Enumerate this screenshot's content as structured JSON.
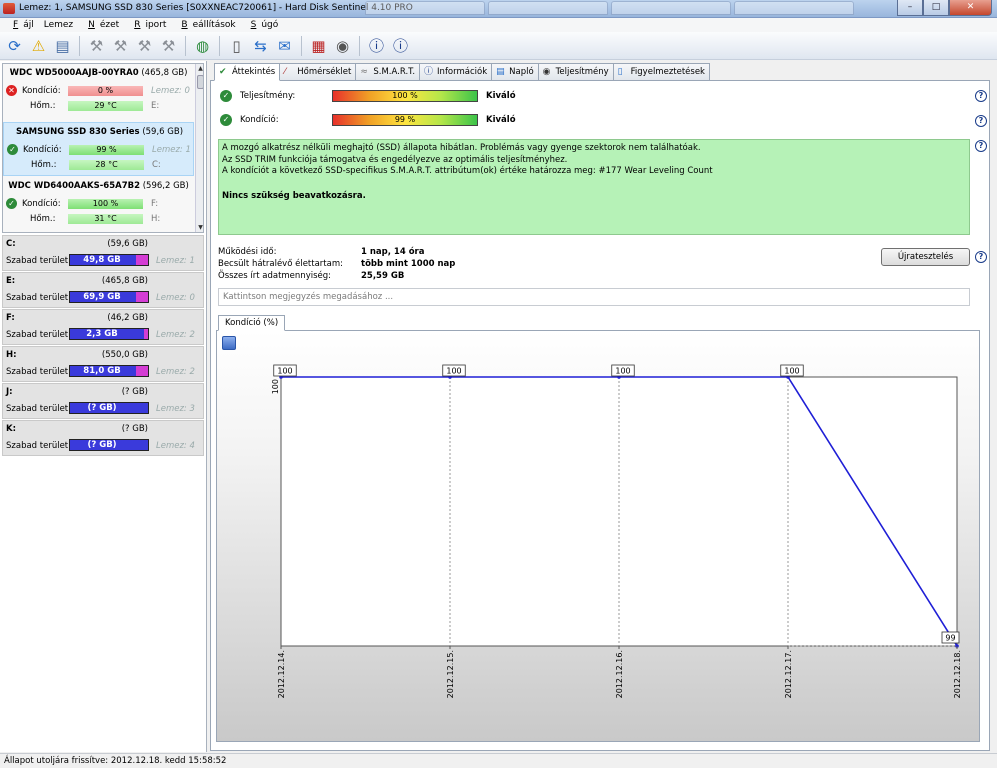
{
  "window": {
    "title": "Lemez: 1, SAMSUNG SSD 830 Series [S0XXNEAC720061]  -  Hard Disk Sentinel 4.10 PRO",
    "minimize": "–",
    "maximize": "□",
    "close": "✕"
  },
  "menu": [
    {
      "label": "Fájl",
      "key": "F"
    },
    {
      "label": "Lemez"
    },
    {
      "label": "Nézet",
      "key": "N"
    },
    {
      "label": "Riport",
      "key": "R"
    },
    {
      "label": "Beállítások",
      "key": "B"
    },
    {
      "label": "Súgó",
      "key": "S"
    }
  ],
  "disks": [
    {
      "name": "WDC WD5000AAJB-00YRA0",
      "size": "(465,8 GB)",
      "condition_label": "Kondíció:",
      "condition": "0 %",
      "temp_label": "Hőm.:",
      "temp": "29 °C",
      "lemez": "Lemez: 0",
      "drive": "E:",
      "status": "bad"
    },
    {
      "name": "SAMSUNG SSD 830 Series",
      "size": "(59,6 GB)",
      "condition_label": "Kondíció:",
      "condition": "99 %",
      "temp_label": "Hőm.:",
      "temp": "28 °C",
      "lemez": "Lemez: 1",
      "drive": "C:",
      "status": "ok"
    },
    {
      "name": "WDC WD6400AAKS-65A7B2",
      "size": "(596,2 GB)",
      "condition_label": "Kondíció:",
      "condition": "100 %",
      "temp_label": "Hőm.:",
      "temp": "31 °C",
      "lemez": "F:",
      "drive": "H:",
      "status": "ok"
    }
  ],
  "volumes": [
    {
      "name": "C:",
      "size": "(59,6 GB)",
      "free_label": "Szabad terület",
      "free": "49,8 GB",
      "lemez": "Lemez: 1",
      "used_fraction": 0.16
    },
    {
      "name": "E:",
      "size": "(465,8 GB)",
      "free_label": "Szabad terület",
      "free": "69,9 GB",
      "lemez": "Lemez: 0",
      "used_fraction": 0.15
    },
    {
      "name": "F:",
      "size": "(46,2 GB)",
      "free_label": "Szabad terület",
      "free": "2,3 GB",
      "lemez": "Lemez: 2",
      "used_fraction": 0.05
    },
    {
      "name": "H:",
      "size": "(550,0 GB)",
      "free_label": "Szabad terület",
      "free": "81,0 GB",
      "lemez": "Lemez: 2",
      "used_fraction": 0.15
    },
    {
      "name": "J:",
      "size": "(? GB)",
      "free_label": "Szabad terület",
      "free": "(? GB)",
      "lemez": "Lemez: 3",
      "used_fraction": 0
    },
    {
      "name": "K:",
      "size": "(? GB)",
      "free_label": "Szabad terület",
      "free": "(? GB)",
      "lemez": "Lemez: 4",
      "used_fraction": 0
    }
  ],
  "tabs": [
    {
      "label": "Áttekintés",
      "icon": "check-icon",
      "active": true
    },
    {
      "label": "Hőmérséklet",
      "icon": "thermometer-icon"
    },
    {
      "label": "S.M.A.R.T.",
      "icon": "smart-icon"
    },
    {
      "label": "Információk",
      "icon": "info-icon"
    },
    {
      "label": "Napló",
      "icon": "log-icon"
    },
    {
      "label": "Teljesítmény",
      "icon": "performance-icon"
    },
    {
      "label": "Figyelmeztetések",
      "icon": "alert-icon"
    }
  ],
  "overview": {
    "performance_label": "Teljesítmény:",
    "performance_value": "100 %",
    "performance_rating": "Kiváló",
    "condition_label": "Kondíció:",
    "condition_value": "99 %",
    "condition_rating": "Kiváló",
    "status_lines": [
      "A mozgó alkatrész nélküli meghajtó (SSD) állapota hibátlan. Problémás vagy gyenge szektorok nem találhatóak.",
      "Az SSD TRIM funkciója támogatva és engedélyezve az optimális teljesítményhez.",
      "A kondíciót a következő SSD-specifikus S.M.A.R.T. attribútum(ok) értéke határozza meg:  #177 Wear Leveling Count"
    ],
    "status_strong": "Nincs szükség beavatkozásra.",
    "uptime_label": "Működési idő:",
    "uptime_value": "1 nap, 14 óra",
    "lifetime_label": "Becsült hátralévő élettartam:",
    "lifetime_value": "több mint 1000 nap",
    "written_label": "Összes írt adatmennyiség:",
    "written_value": "25,59 GB",
    "retest_button": "Újratesztelés",
    "note_placeholder": "Kattintson megjegyzés megadásához ..."
  },
  "chart_tab": "Kondíció  (%)",
  "chart_data": {
    "type": "line",
    "x": [
      "2012.12.14.",
      "2012.12.15.",
      "2012.12.16.",
      "2012.12.17.",
      "2012.12.18."
    ],
    "series": [
      {
        "values": [
          100,
          100,
          100,
          100,
          99
        ],
        "color": "#1f1fd6"
      }
    ],
    "point_labels": [
      "100",
      "100",
      "100",
      "100",
      "99"
    ],
    "y_tick_labels": [
      "100"
    ],
    "ylim": [
      99,
      100
    ],
    "grid": "vertical dotted"
  },
  "statusbar": "Állapot utoljára frissítve: 2012.12.18. kedd 15:58:52",
  "colors": {
    "accent": "#1f1fd6",
    "status_ok": "#2e8b3a",
    "status_bad": "#dd2222",
    "status_panel": "#b6f2b7"
  }
}
